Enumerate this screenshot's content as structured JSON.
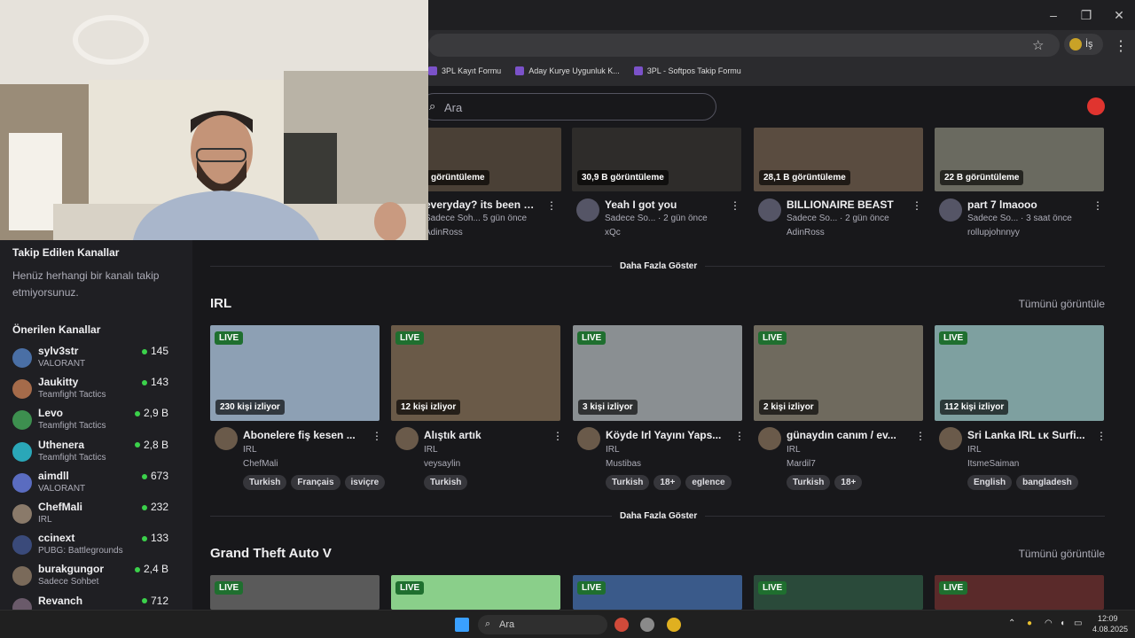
{
  "browser": {
    "bookmarks": [
      "3PL Kayıt Formu",
      "Aday Kurye Uygunluk K...",
      "3PL - Softpos Takip Formu"
    ],
    "profile_label": "İş"
  },
  "header": {
    "search_placeholder": "Ara"
  },
  "sidebar": {
    "followed_title": "Takip Edilen Kanallar",
    "followed_note": "Henüz herhangi bir kanalı takip etmiyorsunuz.",
    "recommended_title": "Önerilen Kanallar",
    "channels": [
      {
        "name": "sylv3str",
        "game": "VALORANT",
        "viewers": "145",
        "color": "#4a6fa5"
      },
      {
        "name": "Jaukitty",
        "game": "Teamfight Tactics",
        "viewers": "143",
        "color": "#a56b4a"
      },
      {
        "name": "Levo",
        "game": "Teamfight Tactics",
        "viewers": "2,9 B",
        "color": "#3d8f4f"
      },
      {
        "name": "Uthenera",
        "game": "Teamfight Tactics",
        "viewers": "2,8 B",
        "color": "#2aa7b8"
      },
      {
        "name": "aimdll",
        "game": "VALORANT",
        "viewers": "673",
        "color": "#5a6cc0"
      },
      {
        "name": "ChefMali",
        "game": "IRL",
        "viewers": "232",
        "color": "#8a7a6a"
      },
      {
        "name": "ccinext",
        "game": "PUBG: Battlegrounds",
        "viewers": "133",
        "color": "#3a4a7a"
      },
      {
        "name": "burakgungor",
        "game": "Sadece Sohbet",
        "viewers": "2,4 B",
        "color": "#7a6a5a"
      },
      {
        "name": "Revanch",
        "game": "",
        "viewers": "712",
        "color": "#6a5a6a"
      }
    ]
  },
  "top_row": [
    {
      "views": "görüntüleme",
      "title": "everyday? its been a...",
      "meta": "Sadece Soh...",
      "age": "5 gün önce",
      "channel": "AdinRoss"
    },
    {
      "views": "30,9 B görüntüleme",
      "title": "Yeah I got you",
      "meta": "Sadece So...",
      "age": "· 2 gün önce",
      "channel": "xQc"
    },
    {
      "views": "28,1 B görüntüleme",
      "title": "BILLIONAIRE BEAST",
      "meta": "Sadece So...",
      "age": "· 2 gün önce",
      "channel": "AdinRoss"
    },
    {
      "views": "22 B görüntüleme",
      "title": "part 7 lmaooo",
      "meta": "Sadece So...",
      "age": "· 3 saat önce",
      "channel": "rollupjohnnyy"
    }
  ],
  "show_more": "Daha Fazla Göster",
  "irl": {
    "title": "IRL",
    "see_all": "Tümünü görüntüle",
    "cards": [
      {
        "live": "LIVE",
        "viewers": "230 kişi izliyor",
        "title": "Abonelere fiş kesen ...",
        "category": "IRL",
        "channel": "ChefMali",
        "tags": [
          "Turkish",
          "Français",
          "isviçre"
        ]
      },
      {
        "live": "LIVE",
        "viewers": "12 kişi izliyor",
        "title": "Alıştık artık",
        "category": "IRL",
        "channel": "veysaylin",
        "tags": [
          "Turkish"
        ]
      },
      {
        "live": "LIVE",
        "viewers": "3 kişi izliyor",
        "title": "Köyde Irl Yayını Yaps...",
        "category": "IRL",
        "channel": "Mustibas",
        "tags": [
          "Turkish",
          "18+",
          "eglence"
        ]
      },
      {
        "live": "LIVE",
        "viewers": "2 kişi izliyor",
        "title": "günaydın canım / ev...",
        "category": "IRL",
        "channel": "Mardil7",
        "tags": [
          "Turkish",
          "18+"
        ]
      },
      {
        "live": "LIVE",
        "viewers": "112 kişi izliyor",
        "title": "Sri Lanka IRL ʟᴋ Surfi...",
        "category": "IRL",
        "channel": "ItsmeSaiman",
        "tags": [
          "English",
          "bangladesh"
        ]
      }
    ]
  },
  "gta": {
    "title": "Grand Theft Auto V",
    "see_all": "Tümünü görüntüle",
    "live": [
      "LIVE",
      "LIVE",
      "LIVE",
      "LIVE",
      "LIVE"
    ]
  },
  "taskbar": {
    "search": "Ara",
    "time": "12:09",
    "date": "4.08.2025"
  }
}
